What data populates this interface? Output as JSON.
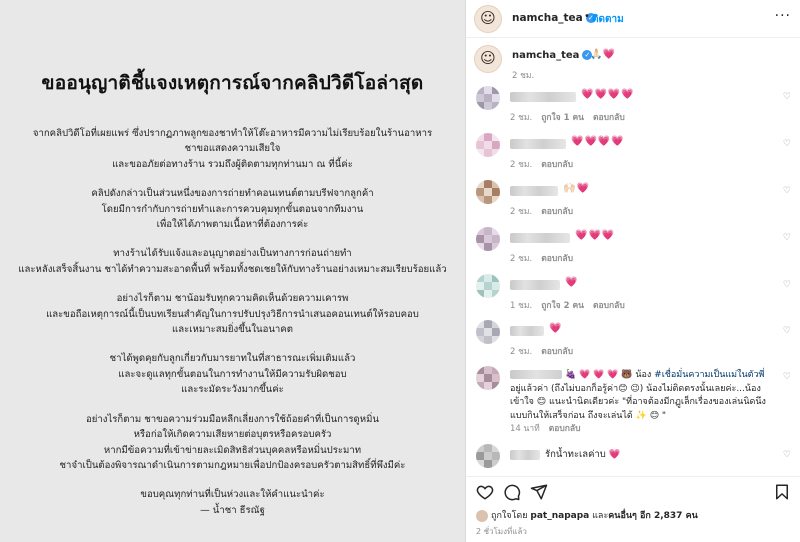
{
  "post": {
    "title": "ขออนุญาติชี้แจงเหตุการณ์จากคลิปวิดีโอล่าสุด",
    "paragraphs": [
      [
        "จากคลิปวิดีโอที่เผยแพร่ ซึ่งปรากฏภาพลูกของชาทำให้โต๊ะอาหารมีความไม่เรียบร้อยในร้านอาหาร",
        "ชาขอแสดงความเสียใจ",
        "และขออภัยต่อทางร้าน รวมถึงผู้ติดตามทุกท่านมา ณ ที่นี้ค่ะ"
      ],
      [
        "คลิปดังกล่าวเป็นส่วนหนึ่งของการถ่ายทำคอนเทนต์ตามบรีฟจากลูกค้า",
        "โดยมีการกำกับการถ่ายทำและการควบคุมทุกขั้นตอนจากทีมงาน",
        "เพื่อให้ได้ภาพตามเนื้อหาที่ต้องการค่ะ"
      ],
      [
        "ทางร้านได้รับแจ้งและอนุญาตอย่างเป็นทางการก่อนถ่ายทำ",
        "และหลังเสร็จสิ้นงาน ชาได้ทำความสะอาดพื้นที่ พร้อมทั้งชดเชยให้กับทางร้านอย่างเหมาะสมเรียบร้อยแล้ว"
      ],
      [
        "อย่างไรก็ตาม ชาน้อมรับทุกความคิดเห็นด้วยความเคารพ",
        "และขอถือเหตุการณ์นี้เป็นบทเรียนสำคัญในการปรับปรุงวิธีการนำเสนอคอนเทนต์ให้รอบคอบ",
        "และเหมาะสมยิ่งขึ้นในอนาคต"
      ],
      [
        "ชาได้พูดคุยกับลูกเกี่ยวกับมารยาทในที่สาธารณะเพิ่มเติมแล้ว",
        "และจะดูแลทุกขั้นตอนในการทำงานให้มีความรับผิดชอบ",
        "และระมัดระวังมากขึ้นค่ะ"
      ],
      [
        "อย่างไรก็ตาม ชาขอความร่วมมือหลีกเลี่ยงการใช้ถ้อยคำที่เป็นการดูหมิ่น",
        "หรือก่อให้เกิดความเสียหายต่อบุตรหรือครอบครัว",
        "หากมีข้อความที่เข้าข่ายละเมิดสิทธิส่วนบุคคลหรือหมิ่นประมาท",
        "ชาจำเป็นต้องพิจารณาดำเนินการตามกฎหมายเพื่อปกป้องครอบครัวตามสิทธิ์ที่พึงมีค่ะ"
      ],
      [
        "ขอบคุณทุกท่านที่เป็นห่วงและให้คำแนะนำค่ะ",
        "— น้ำชา ธีรณัฐ"
      ]
    ]
  },
  "header": {
    "username": "namcha_tea",
    "verified_mark": "✓",
    "separator": "•",
    "follow_label": "ติดตาม",
    "more_label": "···"
  },
  "caption": {
    "username": "namcha_tea",
    "emoji": "🙏🏻💗",
    "time": "2 ชม."
  },
  "comments": [
    {
      "hearts": "💗💗💗💗",
      "time": "2 ชม.",
      "likes": "ถูกใจ 1 คน",
      "reply": "ตอบกลับ"
    },
    {
      "hearts": "💗💗💗💗",
      "time": "2 ชม.",
      "likes": "",
      "reply": "ตอบกลับ"
    },
    {
      "hearts": "🙌🏻💗",
      "time": "2 ชม.",
      "likes": "",
      "reply": "ตอบกลับ"
    },
    {
      "hearts": "💗💗💗",
      "time": "2 ชม.",
      "likes": "",
      "reply": "ตอบกลับ"
    },
    {
      "hearts": "💗",
      "time": "1 ชม.",
      "likes": "ถูกใจ 2 คน",
      "reply": "ตอบกลับ"
    },
    {
      "hearts": "💗",
      "time": "2 ชม.",
      "likes": "",
      "reply": "ตอบกลับ"
    }
  ],
  "long_comment": {
    "prefix": "🍇 💗 💗 💗 🐻 น้อง ",
    "hashtag": "#เชื่อมั่นความเป็นแม่ในตัวพี่",
    "text": " อยู่แล้วค่า (ถึงไม่บอกก็อรู้ค่า😊 😉) น้องไม่ติดตรงนั้นเลยค่ะ...น้องเข้าใจ 😊 แนะนำนิดเดียวค่ะ \"ที่อาจต้องมีกฏูเล็กเรื่องของเล่นนิดนึง แบบกินให้เสร็จก่อน ถึงจะเล่นได้ ✨ 😊 \"",
    "time": "14 นาที",
    "reply": "ตอบกลับ"
  },
  "last_comment": {
    "text": "รักน้ำทะเลค่าบ 💗"
  },
  "likes_line": {
    "prefix": "ถูกใจโดย",
    "liker": "pat_napapa",
    "middle": "และ",
    "others": "คนอื่นๆ อีก 2,837 คน"
  },
  "post_time": "2 ชั่วโมงที่แล้ว",
  "icons": {
    "like": "heart-icon",
    "comment": "comment-icon",
    "share": "share-icon",
    "save": "bookmark-icon"
  },
  "colors": {
    "accent": "#0095f6",
    "heart": "#e8244f",
    "verified": "#3897f0",
    "image_bg": "#e8e8e8"
  }
}
